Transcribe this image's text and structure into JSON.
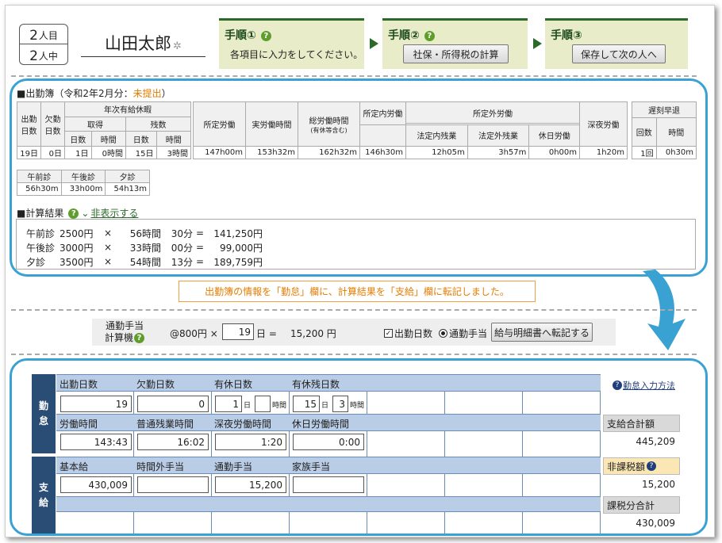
{
  "header": {
    "counter_current": "2",
    "counter_current_unit": "人目",
    "counter_total": "2",
    "counter_total_unit": "人中",
    "employee_name": "山田太郎"
  },
  "steps": [
    {
      "title": "手順①",
      "text": "各項目に入力をしてください。"
    },
    {
      "title": "手順②",
      "button": "社保・所得税の計算"
    },
    {
      "title": "手順③",
      "button": "保存して次の人へ"
    }
  ],
  "attendance": {
    "title_prefix": "■出勤簿（令和2年2月分：",
    "status": "未提出",
    "title_suffix": "）",
    "headers": {
      "work_days": "出勤日数",
      "absent_days": "欠勤日数",
      "paid_leave": "年次有給休暇",
      "taken": "取得",
      "remaining": "残数",
      "days": "日数",
      "hours": "時間",
      "scheduled": "所定労働",
      "actual": "実労働時間",
      "total": "総労働時間",
      "total_note": "(有休等含む)",
      "within": "所定内労働",
      "outside": "所定外労働",
      "legal_in": "法定内残業",
      "legal_out": "法定外残業",
      "holiday": "休日労働",
      "night": "深夜労働",
      "late": "遅刻早退",
      "count": "回数",
      "late_hours": "時間"
    },
    "values": {
      "work_days": "19日",
      "absent_days": "0日",
      "taken_days": "1日",
      "taken_hours": "0時間",
      "remain_days": "15日",
      "remain_hours": "3時間",
      "scheduled": "147h00m",
      "actual": "153h32m",
      "total": "162h32m",
      "within": "146h30m",
      "legal_in": "12h05m",
      "legal_out": "3h57m",
      "holiday": "0h00m",
      "night": "1h20m",
      "late_count": "1回",
      "late_hours": "0h30m"
    },
    "sessions": {
      "headers": [
        "午前診",
        "午後診",
        "夕診"
      ],
      "values": [
        "56h30m",
        "33h00m",
        "54h13m"
      ]
    }
  },
  "calc": {
    "title": "■計算結果",
    "toggle": "非表示する",
    "rows": [
      {
        "name": "午前診",
        "rate": "2500円",
        "times": "×",
        "hours": "56時間",
        "mins": "30分",
        "eq": "=",
        "amount": "141,250円"
      },
      {
        "name": "午後診",
        "rate": "3000円",
        "times": "×",
        "hours": "33時間",
        "mins": "00分",
        "eq": "=",
        "amount": "99,000円"
      },
      {
        "name": "夕診",
        "rate": "3500円",
        "times": "×",
        "hours": "54時間",
        "mins": "13分",
        "eq": "=",
        "amount": "189,759円"
      }
    ]
  },
  "notice": "出勤簿の情報を「勤怠」欄に、計算結果を「支給」欄に転記しました。",
  "commute": {
    "label_line1": "通勤手当",
    "label_line2": "計算機",
    "rate": "@800円 ×",
    "days": "19",
    "unit": "日 =",
    "result": "15,200 円",
    "check_label": "出勤日数",
    "radio_label": "通勤手当",
    "button": "給与明細書へ転記する"
  },
  "kintai": {
    "side": [
      "勤",
      "怠"
    ],
    "help_link": "勤怠入力方法",
    "labels": [
      "出勤日数",
      "欠勤日数",
      "有休日数",
      "有休残日数"
    ],
    "work_days": "19",
    "absent_days": "0",
    "leave_days": "1",
    "leave_hours": "",
    "remain_days": "15",
    "remain_hours": "3",
    "unit_day": "日",
    "unit_hour": "時間",
    "labels2": [
      "労働時間",
      "普通残業時間",
      "深夜労働時間",
      "休日労働時間"
    ],
    "work_time": "143:43",
    "overtime": "16:02",
    "night": "1:20",
    "holiday": "0:00"
  },
  "shikyu": {
    "side": [
      "支",
      "給"
    ],
    "labels": [
      "基本給",
      "時間外手当",
      "通勤手当",
      "家族手当"
    ],
    "base": "430,009",
    "overtime_pay": "",
    "commute": "15,200",
    "family": ""
  },
  "summary": {
    "total_label": "支給合計額",
    "total": "445,209",
    "nontax_label": "非課税額",
    "nontax": "15,200",
    "taxable_label": "課税分合計",
    "taxable": "430,009"
  },
  "colors": {
    "accent": "#3aa2d2",
    "step_green": "#2c6a2a",
    "header_blue": "#2a4d75",
    "status_orange": "#e57c00"
  }
}
